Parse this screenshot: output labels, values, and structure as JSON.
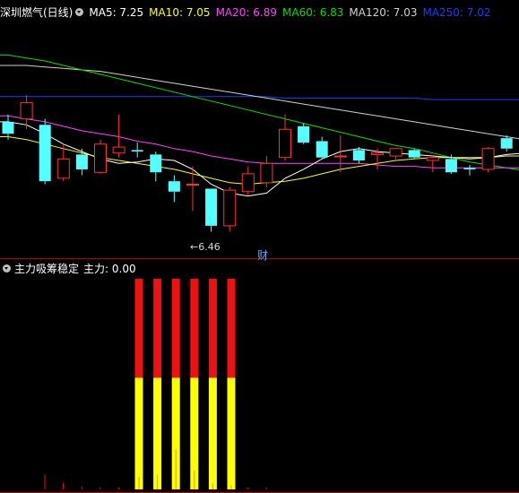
{
  "header": {
    "stock_title": "深圳燃气(日线)",
    "ma_items": [
      {
        "label": "MA5: 7.25",
        "color": "#ffffff"
      },
      {
        "label": "MA10: 7.05",
        "color": "#ffff00"
      },
      {
        "label": "MA20: 6.89",
        "color": "#ff44ff"
      },
      {
        "label": "MA60: 6.83",
        "color": "#00e000"
      },
      {
        "label": "MA120: 7.03",
        "color": "#d0d0d0"
      },
      {
        "label": "MA250: 7.02",
        "color": "#1a3cff"
      }
    ]
  },
  "indicator": {
    "title": "主力吸筹稳定",
    "value_label": "主力: 0.00"
  },
  "annotations": {
    "low_label": "6.46",
    "event_badge": "财"
  },
  "colors": {
    "up": "#ff3232",
    "down": "#54ffff",
    "bar_red": "#ee1111",
    "bar_yellow": "#ffff00",
    "separator": "#b00000"
  },
  "chart_data": [
    {
      "type": "candlestick",
      "title": "深圳燃气(日线)",
      "ylim": [
        6.3,
        7.9
      ],
      "candles": [
        {
          "o": 7.2,
          "h": 7.25,
          "l": 7.08,
          "c": 7.12
        },
        {
          "o": 7.22,
          "h": 7.38,
          "l": 7.15,
          "c": 7.33
        },
        {
          "o": 7.18,
          "h": 7.22,
          "l": 6.78,
          "c": 6.8
        },
        {
          "o": 6.82,
          "h": 7.05,
          "l": 6.8,
          "c": 6.95
        },
        {
          "o": 6.98,
          "h": 7.02,
          "l": 6.84,
          "c": 6.88
        },
        {
          "o": 6.86,
          "h": 7.08,
          "l": 6.85,
          "c": 7.05
        },
        {
          "o": 6.99,
          "h": 7.25,
          "l": 6.96,
          "c": 7.03
        },
        {
          "o": 7.01,
          "h": 7.06,
          "l": 6.96,
          "c": 7.0
        },
        {
          "o": 6.98,
          "h": 7.0,
          "l": 6.8,
          "c": 6.86
        },
        {
          "o": 6.8,
          "h": 6.84,
          "l": 6.66,
          "c": 6.73
        },
        {
          "o": 6.78,
          "h": 6.9,
          "l": 6.6,
          "c": 6.78
        },
        {
          "o": 6.75,
          "h": 6.75,
          "l": 6.46,
          "c": 6.5
        },
        {
          "o": 6.5,
          "h": 6.76,
          "l": 6.46,
          "c": 6.74
        },
        {
          "o": 6.73,
          "h": 6.9,
          "l": 6.7,
          "c": 6.85
        },
        {
          "o": 6.79,
          "h": 6.97,
          "l": 6.76,
          "c": 6.92
        },
        {
          "o": 6.96,
          "h": 7.25,
          "l": 6.94,
          "c": 7.15
        },
        {
          "o": 7.17,
          "h": 7.19,
          "l": 7.05,
          "c": 7.06
        },
        {
          "o": 7.07,
          "h": 7.1,
          "l": 6.95,
          "c": 6.96
        },
        {
          "o": 6.97,
          "h": 7.11,
          "l": 6.86,
          "c": 6.97
        },
        {
          "o": 7.01,
          "h": 7.03,
          "l": 6.92,
          "c": 6.94
        },
        {
          "o": 6.98,
          "h": 7.02,
          "l": 6.88,
          "c": 6.99
        },
        {
          "o": 6.97,
          "h": 7.02,
          "l": 6.95,
          "c": 7.02
        },
        {
          "o": 7.01,
          "h": 7.02,
          "l": 6.95,
          "c": 6.96
        },
        {
          "o": 6.94,
          "h": 6.97,
          "l": 6.86,
          "c": 6.96
        },
        {
          "o": 6.95,
          "h": 6.98,
          "l": 6.85,
          "c": 6.86
        },
        {
          "o": 6.89,
          "h": 6.91,
          "l": 6.84,
          "c": 6.88
        },
        {
          "o": 6.88,
          "h": 7.03,
          "l": 6.86,
          "c": 7.02
        },
        {
          "o": 7.09,
          "h": 7.11,
          "l": 7.0,
          "c": 7.02
        },
        {
          "o": 7.0,
          "h": 7.05,
          "l": 6.95,
          "c": 6.97
        },
        {
          "o": 7.0,
          "h": 7.02,
          "l": 6.96,
          "c": 6.99
        },
        {
          "o": 7.01,
          "h": 7.04,
          "l": 6.94,
          "c": 6.96
        }
      ],
      "ma_series": [
        {
          "name": "MA5",
          "color": "#ffffff",
          "values": [
            7.2,
            7.18,
            7.12,
            7.05,
            7.0,
            6.95,
            6.92,
            6.93,
            6.95,
            6.94,
            6.88,
            6.78,
            6.72,
            6.7,
            6.72,
            6.82,
            6.88,
            6.95,
            7.0,
            7.02,
            7.0,
            6.99,
            6.98,
            6.97,
            6.96,
            6.95,
            6.96,
            6.98,
            6.99,
            6.99,
            7.0
          ]
        },
        {
          "name": "MA10",
          "color": "#ffff00",
          "values": [
            7.1,
            7.08,
            7.05,
            7.02,
            6.99,
            6.96,
            6.94,
            6.92,
            6.9,
            6.88,
            6.85,
            6.82,
            6.79,
            6.78,
            6.79,
            6.8,
            6.82,
            6.85,
            6.88,
            6.9,
            6.92,
            6.94,
            6.95,
            6.96,
            6.96,
            6.96,
            6.96,
            6.97,
            6.97,
            6.98,
            6.98
          ]
        },
        {
          "name": "MA20",
          "color": "#ff44ff",
          "values": [
            7.24,
            7.22,
            7.2,
            7.17,
            7.14,
            7.12,
            7.1,
            7.07,
            7.05,
            7.02,
            7.0,
            6.97,
            6.95,
            6.93,
            6.92,
            6.92,
            6.92,
            6.92,
            6.92,
            6.92,
            6.91,
            6.9,
            6.9,
            6.89,
            6.89,
            6.89,
            6.89,
            6.89,
            6.89,
            6.89,
            6.89
          ]
        },
        {
          "name": "MA60",
          "color": "#00e000",
          "values": [
            7.65,
            7.63,
            7.61,
            7.58,
            7.55,
            7.52,
            7.49,
            7.46,
            7.43,
            7.4,
            7.37,
            7.34,
            7.31,
            7.28,
            7.25,
            7.22,
            7.19,
            7.16,
            7.13,
            7.1,
            7.07,
            7.04,
            7.02,
            6.99,
            6.96,
            6.93,
            6.91,
            6.89,
            6.87,
            6.85,
            6.83
          ]
        },
        {
          "name": "MA120",
          "color": "#d0d0d0",
          "values": [
            7.58,
            7.58,
            7.57,
            7.56,
            7.55,
            7.54,
            7.52,
            7.5,
            7.48,
            7.46,
            7.44,
            7.42,
            7.4,
            7.38,
            7.36,
            7.34,
            7.32,
            7.3,
            7.28,
            7.26,
            7.24,
            7.22,
            7.2,
            7.18,
            7.16,
            7.14,
            7.12,
            7.1,
            7.08,
            7.06,
            7.04
          ]
        },
        {
          "name": "MA250",
          "color": "#1a3cff",
          "values": [
            7.37,
            7.37,
            7.37,
            7.37,
            7.37,
            7.37,
            7.37,
            7.37,
            7.37,
            7.37,
            7.37,
            7.37,
            7.37,
            7.37,
            7.37,
            7.36,
            7.36,
            7.36,
            7.36,
            7.36,
            7.36,
            7.36,
            7.36,
            7.35,
            7.35,
            7.35,
            7.35,
            7.35,
            7.35,
            7.35,
            7.35
          ]
        }
      ],
      "low_point": 6.46
    },
    {
      "type": "bar",
      "title": "主力吸筹稳定",
      "ylim": [
        0,
        100
      ],
      "series": [
        {
          "name": "主力",
          "values": [
            0,
            0,
            1.7,
            0,
            0.8,
            0,
            0.5,
            0,
            0.4,
            0,
            0.3,
            0,
            0.3,
            0,
            0.3,
            0,
            0,
            0,
            0,
            0,
            0,
            0,
            0,
            0,
            0,
            0,
            0,
            0,
            0,
            0,
            0,
            0,
            0,
            0
          ]
        }
      ],
      "stacked_bars": [
        {
          "index": 7,
          "yellow": 53,
          "red": 100,
          "inner": 6
        },
        {
          "index": 8,
          "yellow": 53,
          "red": 100,
          "inner": 7
        },
        {
          "index": 9,
          "yellow": 53,
          "red": 100,
          "inner": 19
        },
        {
          "index": 10,
          "yellow": 53,
          "red": 100,
          "inner": 9
        },
        {
          "index": 11,
          "yellow": 53,
          "red": 100,
          "inner": 3
        },
        {
          "index": 12,
          "yellow": 53,
          "red": 100,
          "inner": 2
        }
      ],
      "small_bars": [
        {
          "index": 2,
          "value": 7
        },
        {
          "index": 3,
          "value": 3
        },
        {
          "index": 4,
          "value": 1.5
        },
        {
          "index": 5,
          "value": 1
        },
        {
          "index": 6,
          "value": 1
        },
        {
          "index": 13,
          "value": 1
        },
        {
          "index": 14,
          "value": 1
        }
      ]
    }
  ]
}
